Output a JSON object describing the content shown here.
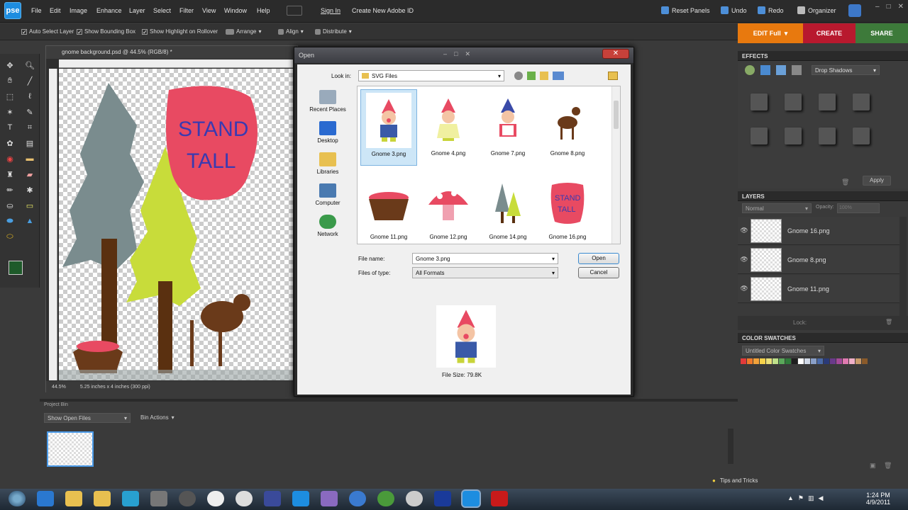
{
  "app": {
    "logo": "pse"
  },
  "menus": [
    "File",
    "Edit",
    "Image",
    "Enhance",
    "Layer",
    "Select",
    "Filter",
    "View",
    "Window",
    "Help"
  ],
  "top_links": {
    "sign_in": "Sign In",
    "create_id": "Create New Adobe ID"
  },
  "top_actions": {
    "reset_panels": "Reset Panels",
    "undo": "Undo",
    "redo": "Redo",
    "organizer": "Organizer"
  },
  "options": {
    "auto_select": "Auto Select Layer",
    "bounding_box": "Show Bounding Box",
    "highlight": "Show Highlight on Rollover",
    "arrange": "Arrange",
    "align": "Align",
    "distribute": "Distribute"
  },
  "mode_tabs": {
    "edit": "EDIT Full",
    "create": "CREATE",
    "share": "SHARE"
  },
  "document": {
    "title": "gnome background.psd @ 44.5% (RGB/8) *",
    "zoom": "44.5%",
    "info": "5.25 inches x 4 inches (300 ppi)",
    "artwork_text_1": "STAND",
    "artwork_text_2": "TALL"
  },
  "dialog": {
    "title": "Open",
    "look_in_label": "Look in:",
    "look_in_value": "SVG Files",
    "places": [
      "Recent Places",
      "Desktop",
      "Libraries",
      "Computer",
      "Network"
    ],
    "files": [
      {
        "name": "Gnome 3.png",
        "selected": true
      },
      {
        "name": "Gnome 4.png",
        "selected": false
      },
      {
        "name": "Gnome 7.png",
        "selected": false
      },
      {
        "name": "Gnome 8.png",
        "selected": false
      },
      {
        "name": "Gnome 11.png",
        "selected": false
      },
      {
        "name": "Gnome 12.png",
        "selected": false
      },
      {
        "name": "Gnome 14.png",
        "selected": false
      },
      {
        "name": "Gnome 16.png",
        "selected": false
      }
    ],
    "file_name_label": "File name:",
    "file_name_value": "Gnome 3.png",
    "file_type_label": "Files of type:",
    "file_type_value": "All Formats",
    "open_btn": "Open",
    "cancel_btn": "Cancel",
    "file_size": "File Size: 79.8K"
  },
  "effects": {
    "title": "EFFECTS",
    "filter": "Drop Shadows",
    "apply": "Apply"
  },
  "layers": {
    "title": "LAYERS",
    "mode": "Normal",
    "opacity_label": "Opacity:",
    "opacity": "100%",
    "lock": "Lock:",
    "rows": [
      "Gnome 16.png",
      "Gnome 8.png",
      "Gnome 11.png"
    ]
  },
  "swatches": {
    "title": "COLOR SWATCHES",
    "set": "Untitled Color Swatches",
    "colors": [
      "#e23a3a",
      "#f07a2a",
      "#f2a23a",
      "#f6d24a",
      "#e9e07a",
      "#bfe08a",
      "#5aa85a",
      "#2f7a3a",
      "#1e1e1e",
      "#ffffff",
      "#cfd7e6",
      "#8aa0c8",
      "#4a6aa8",
      "#2a3a78",
      "#6a3a8a",
      "#a64a9a",
      "#e07ab0",
      "#f0b0c8",
      "#c89a6a",
      "#8a5a2a"
    ]
  },
  "project_bin": {
    "title": "Project Bin",
    "show": "Show Open Files",
    "actions": "Bin Actions",
    "tips": "Tips and Tricks"
  },
  "taskbar": {
    "time": "1:24 PM",
    "date": "4/9/2011"
  }
}
